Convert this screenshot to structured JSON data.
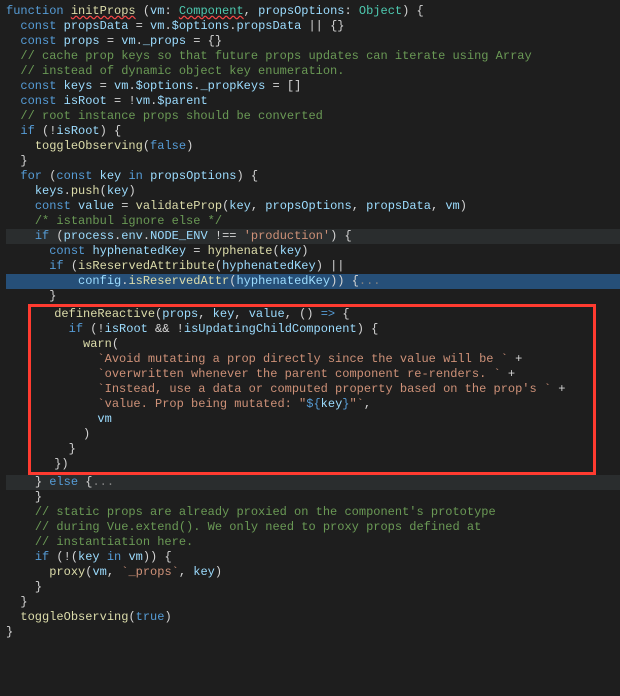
{
  "code": {
    "l01_a": "function",
    "l01_b": "initProps",
    "l01_c": "vm",
    "l01_d": "Component",
    "l01_e": "propsOptions",
    "l01_f": "Object",
    "l02_a": "const",
    "l02_b": "propsData",
    "l02_c": "vm",
    "l02_d": "$options",
    "l02_e": "propsData",
    "l03_a": "const",
    "l03_b": "props",
    "l03_c": "vm",
    "l03_d": "_props",
    "l04": "// cache prop keys so that future props updates can iterate using Array",
    "l05": "// instead of dynamic object key enumeration.",
    "l06_a": "const",
    "l06_b": "keys",
    "l06_c": "vm",
    "l06_d": "$options",
    "l06_e": "_propKeys",
    "l07_a": "const",
    "l07_b": "isRoot",
    "l07_c": "vm",
    "l07_d": "$parent",
    "l08": "// root instance props should be converted",
    "l09_a": "if",
    "l09_b": "isRoot",
    "l10_a": "toggleObserving",
    "l10_b": "false",
    "l11": "}",
    "l12_a": "for",
    "l12_b": "const",
    "l12_c": "key",
    "l12_d": "in",
    "l12_e": "propsOptions",
    "l13_a": "keys",
    "l13_b": "push",
    "l13_c": "key",
    "l14_a": "const",
    "l14_b": "value",
    "l14_c": "validateProp",
    "l14_d": "key",
    "l14_e": "propsOptions",
    "l14_f": "propsData",
    "l14_g": "vm",
    "l15": "/* istanbul ignore else */",
    "l16_a": "if",
    "l16_b": "process",
    "l16_c": "env",
    "l16_d": "NODE_ENV",
    "l16_e": "'production'",
    "l17_a": "const",
    "l17_b": "hyphenatedKey",
    "l17_c": "hyphenate",
    "l17_d": "key",
    "l18_a": "if",
    "l18_b": "isReservedAttribute",
    "l18_c": "hyphenatedKey",
    "l19_a": "config",
    "l19_b": "isReservedAttr",
    "l19_c": "hyphenatedKey",
    "l19_fold": "...",
    "l20": "}",
    "l21_a": "defineReactive",
    "l21_b": "props",
    "l21_c": "key",
    "l21_d": "value",
    "l22_a": "if",
    "l22_b": "isRoot",
    "l22_c": "isUpdatingChildComponent",
    "l23_a": "warn",
    "l24": "`Avoid mutating a prop directly since the value will be `",
    "l25": "`overwritten whenever the parent component re-renders. `",
    "l26": "`Instead, use a data or computed property based on the prop's `",
    "l27_a": "`value. Prop being mutated: \"",
    "l27_b": "key",
    "l27_c": "\"`",
    "l28": "vm",
    "l29": ")",
    "l30": "}",
    "l31": "})",
    "l32_a": "}",
    "l32_b": "else",
    "l32_fold": "...",
    "l33": "}",
    "l34": "// static props are already proxied on the component's prototype",
    "l35": "// during Vue.extend(). We only need to proxy props defined at",
    "l36": "// instantiation here.",
    "l37_a": "if",
    "l37_b": "key",
    "l37_c": "in",
    "l37_d": "vm",
    "l38_a": "proxy",
    "l38_b": "vm",
    "l38_c": "`_props`",
    "l38_d": "key",
    "l39": "}",
    "l40": "}",
    "l41_a": "toggleObserving",
    "l41_b": "true",
    "l42": "}"
  }
}
